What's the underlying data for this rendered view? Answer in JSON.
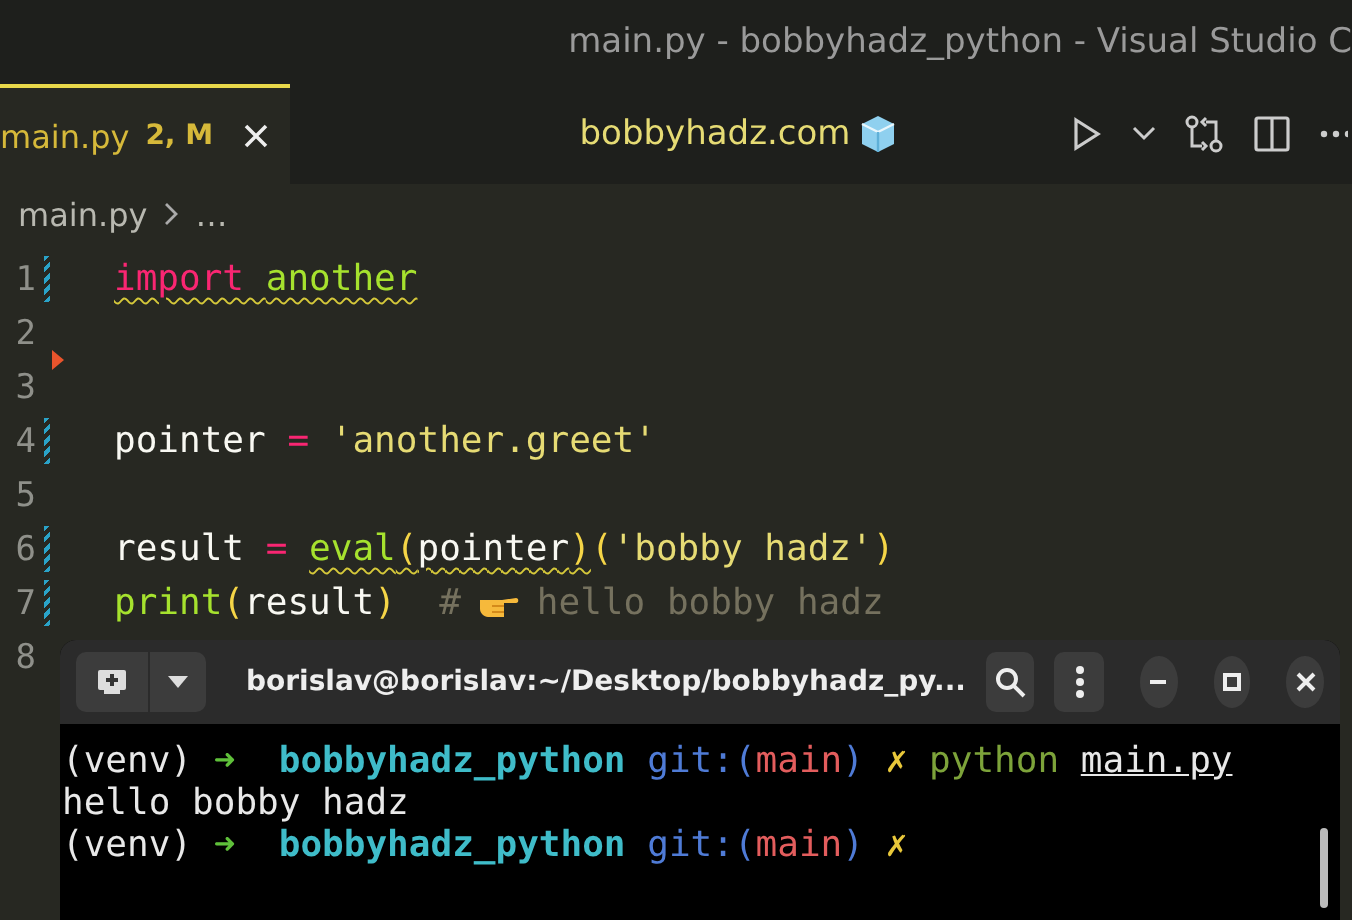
{
  "window": {
    "title": "main.py - bobbyhadz_python - Visual Studio C"
  },
  "tabs": [
    {
      "label": "main.py",
      "badge": "2, M",
      "selected": true
    }
  ],
  "center_title": "bobbyhadz.com",
  "breadcrumb": [
    "main.py",
    "…"
  ],
  "editor": {
    "lines": [
      {
        "number": "1",
        "modified": true,
        "tokens": [
          {
            "kind": "keyword",
            "text": "import ",
            "squiggle": true
          },
          {
            "kind": "module",
            "text": "another",
            "squiggle": true
          }
        ]
      },
      {
        "number": "2",
        "modified": false,
        "marker": true
      },
      {
        "number": "3",
        "modified": false
      },
      {
        "number": "4",
        "modified": true,
        "tokens": [
          {
            "kind": "plain",
            "text": "pointer "
          },
          {
            "kind": "op",
            "text": "="
          },
          {
            "kind": "string",
            "text": " 'another.greet'"
          }
        ]
      },
      {
        "number": "5",
        "modified": false
      },
      {
        "number": "6",
        "modified": true,
        "tokens": [
          {
            "kind": "plain",
            "text": "result "
          },
          {
            "kind": "op",
            "text": "= "
          },
          {
            "kind": "func",
            "text": "eval",
            "squiggle": true
          },
          {
            "kind": "paren",
            "text": "(",
            "squiggle": true
          },
          {
            "kind": "plain",
            "text": "pointer",
            "squiggle": true
          },
          {
            "kind": "paren",
            "text": ")",
            "squiggle": true
          },
          {
            "kind": "paren",
            "text": "("
          },
          {
            "kind": "string",
            "text": "'bobby hadz'"
          },
          {
            "kind": "paren",
            "text": ")"
          }
        ]
      },
      {
        "number": "7",
        "modified": true,
        "tokens": [
          {
            "kind": "func",
            "text": "print"
          },
          {
            "kind": "paren",
            "text": "("
          },
          {
            "kind": "plain",
            "text": "result"
          },
          {
            "kind": "paren",
            "text": ")"
          },
          {
            "kind": "comment",
            "text": "  #"
          },
          {
            "kind": "hand"
          },
          {
            "kind": "comment",
            "text": "hello bobby hadz"
          }
        ]
      },
      {
        "number": "8",
        "modified": false
      }
    ]
  },
  "terminal": {
    "title": "borislav@borislav:~/Desktop/bobbyhadz_py...",
    "lines": [
      [
        {
          "kind": "plain",
          "text": "(venv) "
        },
        {
          "kind": "arrow",
          "text": "➜"
        },
        {
          "kind": "dir",
          "text": "  bobbyhadz_python "
        },
        {
          "kind": "git",
          "text": "git:("
        },
        {
          "kind": "branch",
          "text": "main"
        },
        {
          "kind": "git",
          "text": ") "
        },
        {
          "kind": "dirty",
          "text": "✗ "
        },
        {
          "kind": "cmd",
          "text": "python "
        },
        {
          "kind": "arg",
          "text": "main.py"
        }
      ],
      [
        {
          "kind": "plain",
          "text": "hello bobby hadz"
        }
      ],
      [
        {
          "kind": "plain",
          "text": "(venv) "
        },
        {
          "kind": "arrow",
          "text": "➜"
        },
        {
          "kind": "dir",
          "text": "  bobbyhadz_python "
        },
        {
          "kind": "git",
          "text": "git:("
        },
        {
          "kind": "branch",
          "text": "main"
        },
        {
          "kind": "git",
          "text": ") "
        },
        {
          "kind": "dirty",
          "text": "✗"
        }
      ]
    ]
  }
}
